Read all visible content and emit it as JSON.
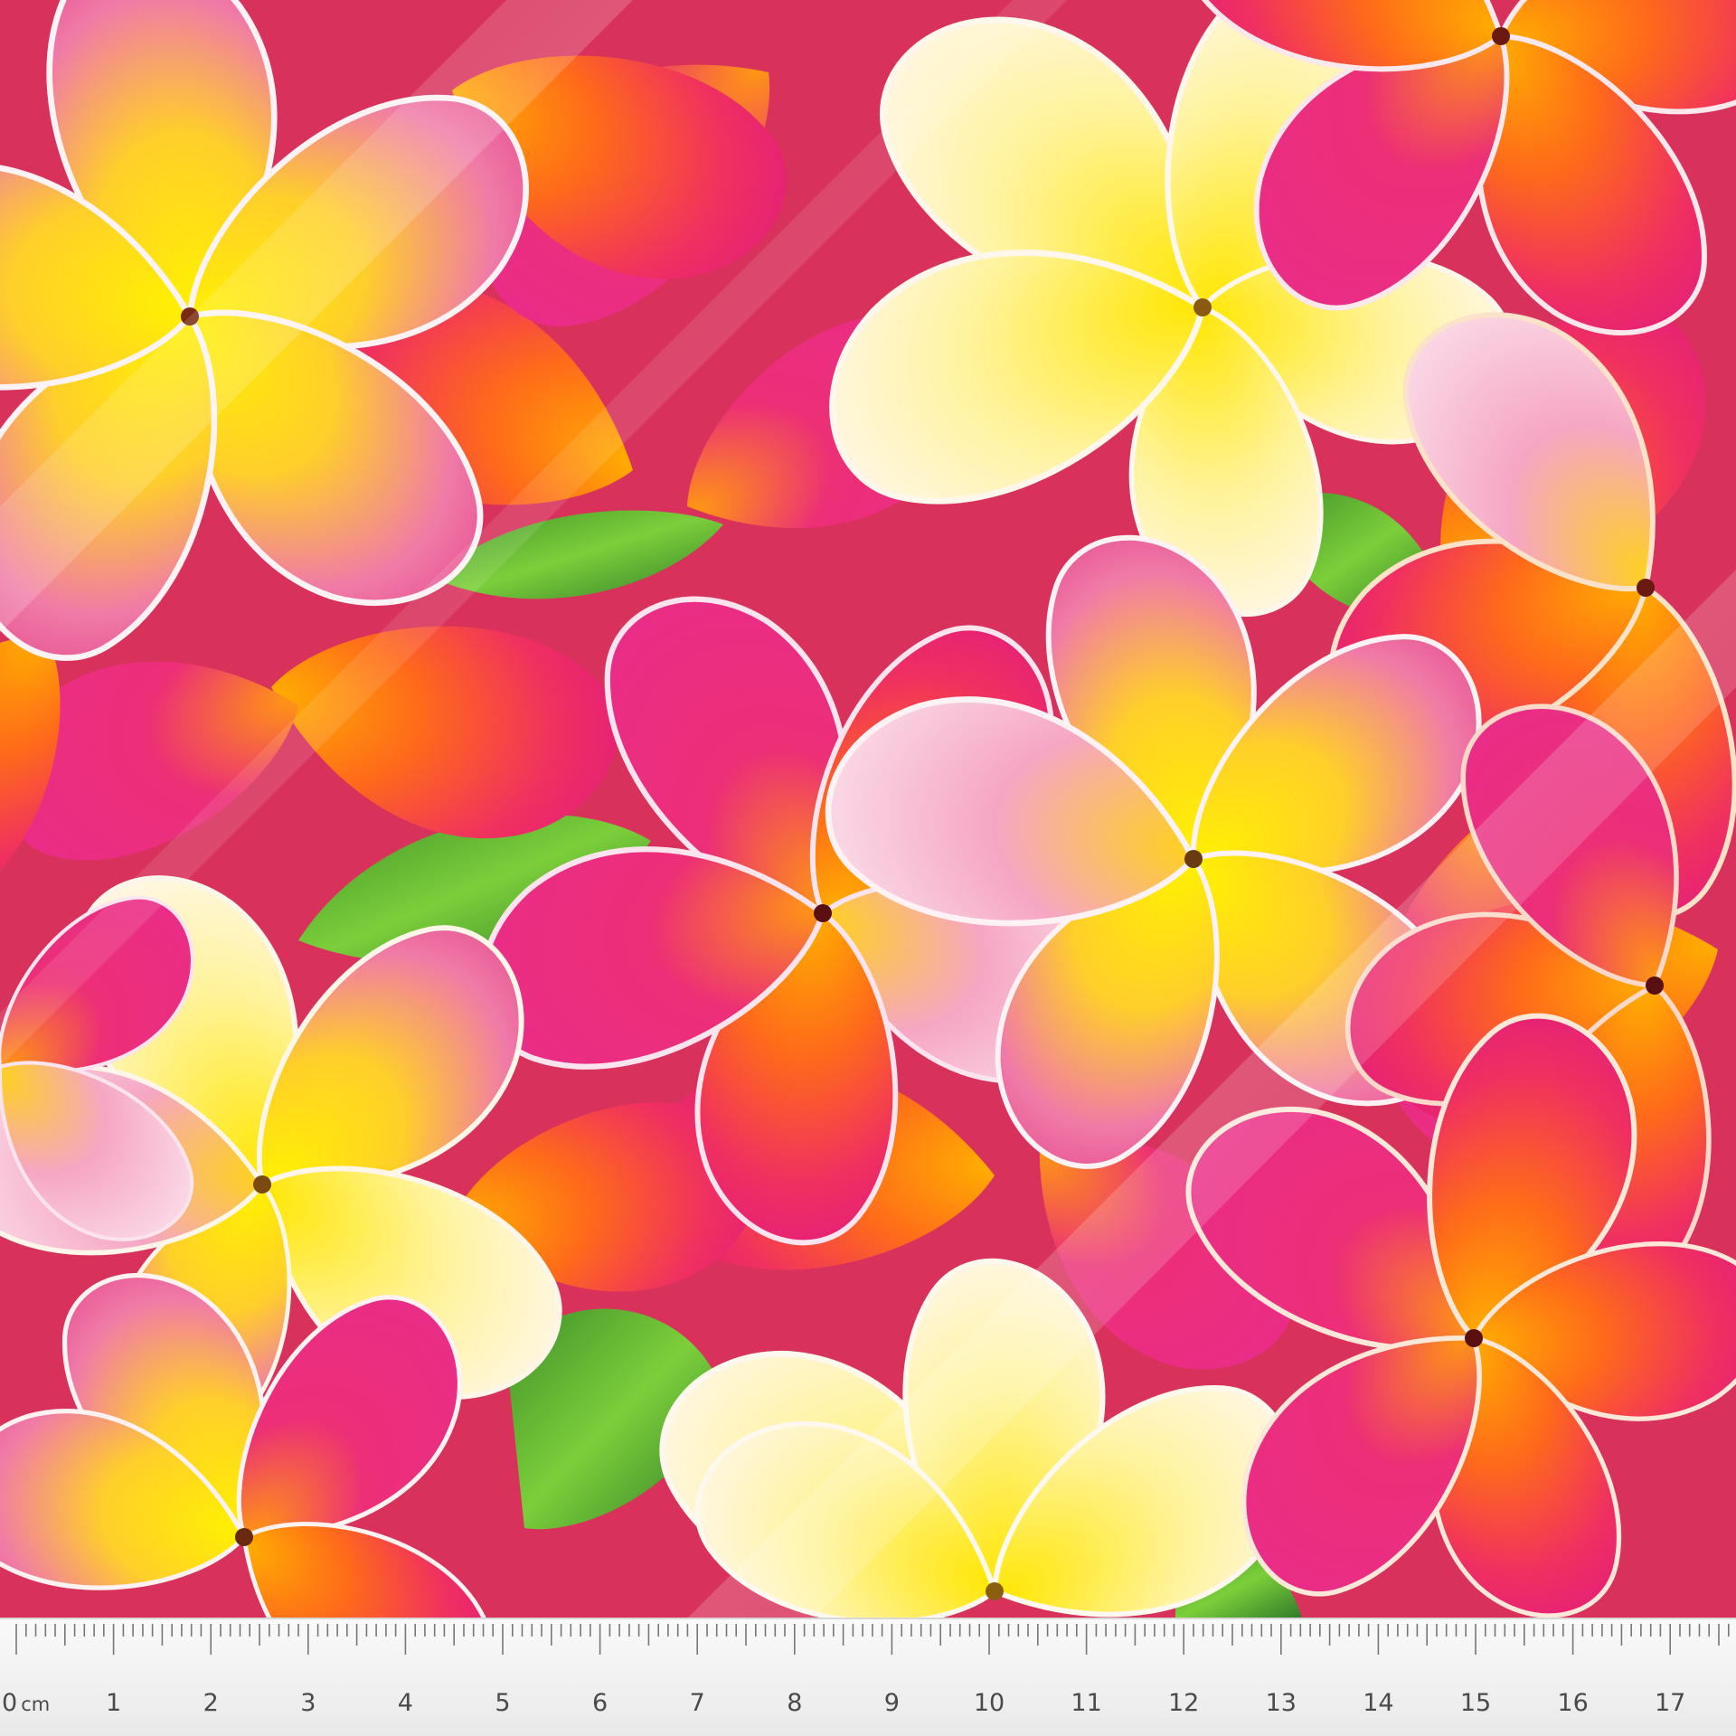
{
  "image": {
    "subject": "frangipani-fabric-swatch"
  },
  "ruler": {
    "unit": "cm",
    "labels": [
      "0",
      "1",
      "2",
      "3",
      "4",
      "5",
      "6",
      "7",
      "8",
      "9",
      "10",
      "11",
      "12",
      "13",
      "14",
      "15",
      "16",
      "17"
    ]
  },
  "colors": {
    "magenta": "#e3267a",
    "pink": "#f07fb1",
    "yellow": "#ffd81a",
    "orange": "#ff7a17",
    "red": "#f0323a",
    "white": "#fdf4ee",
    "leaf": "#5ab33a",
    "ruler": "#f1f1f1"
  }
}
